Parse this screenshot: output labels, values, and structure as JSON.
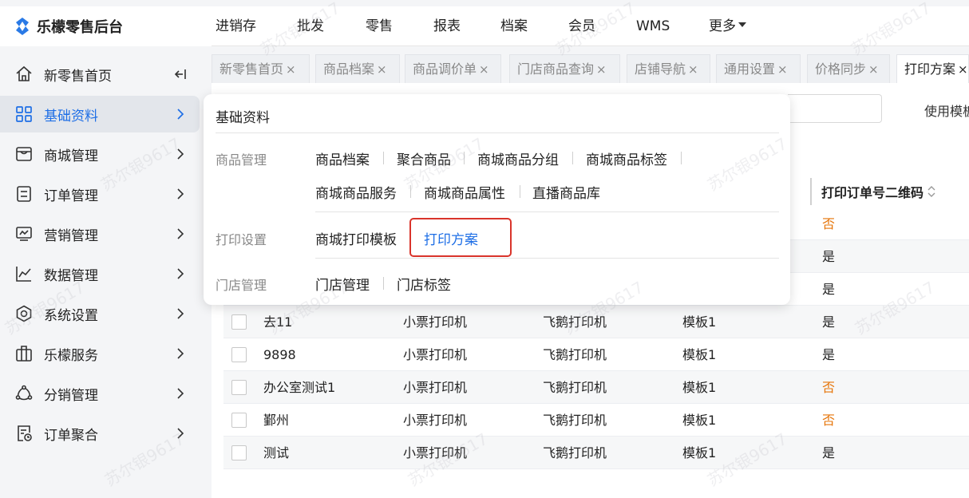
{
  "app": {
    "title": "乐檬零售后台"
  },
  "topnav": [
    "进销存",
    "批发",
    "零售",
    "报表",
    "档案",
    "会员",
    "WMS",
    "更多"
  ],
  "sidebar": {
    "items": [
      {
        "label": "新零售首页",
        "icon": "home-icon"
      },
      {
        "label": "基础资料",
        "icon": "grid-icon"
      },
      {
        "label": "商城管理",
        "icon": "store-icon"
      },
      {
        "label": "订单管理",
        "icon": "order-icon"
      },
      {
        "label": "营销管理",
        "icon": "monitor-icon"
      },
      {
        "label": "数据管理",
        "icon": "chart-icon"
      },
      {
        "label": "系统设置",
        "icon": "settings-icon"
      },
      {
        "label": "乐檬服务",
        "icon": "service-icon"
      },
      {
        "label": "分销管理",
        "icon": "distribution-icon"
      },
      {
        "label": "订单聚合",
        "icon": "order-merge-icon"
      }
    ]
  },
  "tabs": [
    "新零售首页",
    "商品档案",
    "商品调价单",
    "门店商品查询",
    "店铺导航",
    "通用设置",
    "价格同步",
    "打印方案"
  ],
  "tab_close": "×",
  "toolbar": {
    "use_template": "使用模板"
  },
  "table": {
    "header_qr": "打印订单号二维码",
    "partial_values": [
      "否",
      "是",
      "是"
    ],
    "rows": [
      {
        "name": "去11",
        "type": "小票打印机",
        "printer": "飞鹅打印机",
        "template": "模板1",
        "qr": "是"
      },
      {
        "name": "9898",
        "type": "小票打印机",
        "printer": "飞鹅打印机",
        "template": "模板1",
        "qr": "是"
      },
      {
        "name": "办公室测试1",
        "type": "小票打印机",
        "printer": "飞鹅打印机",
        "template": "模板1",
        "qr": "否"
      },
      {
        "name": "鄞州",
        "type": "小票打印机",
        "printer": "飞鹅打印机",
        "template": "模板1",
        "qr": "否"
      },
      {
        "name": "测试",
        "type": "小票打印机",
        "printer": "飞鹅打印机",
        "template": "模板1",
        "qr": "是"
      }
    ]
  },
  "panel": {
    "title": "基础资料",
    "groups": [
      {
        "label": "商品管理",
        "items": [
          "商品档案",
          "聚合商品",
          "商城商品分组",
          "商城商品标签",
          "商城商品服务",
          "商城商品属性",
          "直播商品库"
        ]
      },
      {
        "label": "打印设置",
        "items": [
          "商城打印模板",
          "打印方案"
        ]
      },
      {
        "label": "门店管理",
        "items": [
          "门店管理",
          "门店标签"
        ]
      }
    ]
  },
  "watermark": "苏尔银9617",
  "colors": {
    "accent": "#1f6fe6",
    "negative": "#e6750a",
    "highlight": "#d9342b"
  }
}
